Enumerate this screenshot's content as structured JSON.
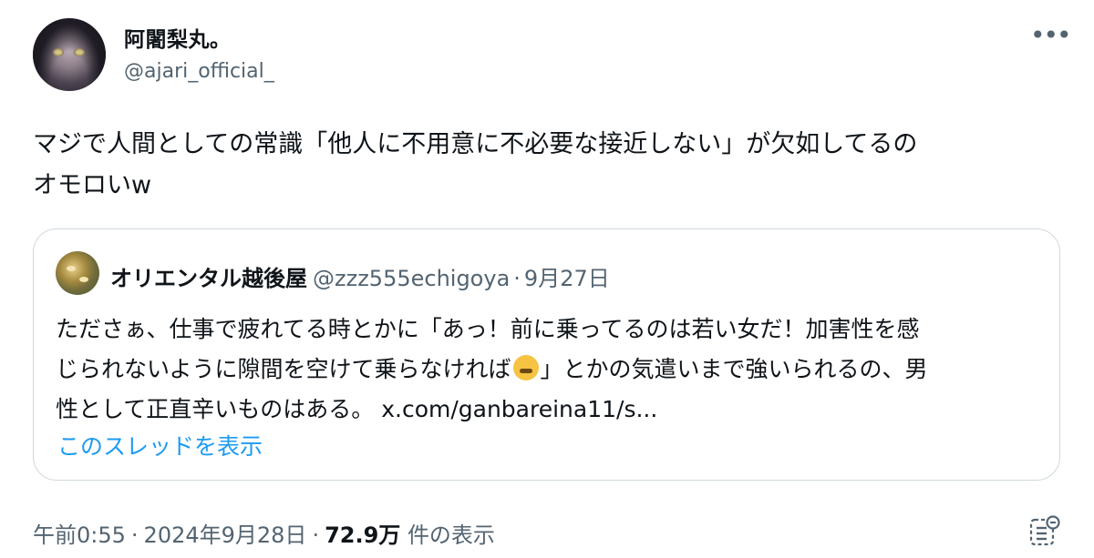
{
  "tweet": {
    "author_name": "阿闍梨丸。",
    "author_handle": "@ajari_official_",
    "more_label": "•••",
    "text_line1": "マジで人間としての常識「他人に不用意に不必要な接近しない」が欠如してるの",
    "text_line2": "オモロいw",
    "time": "午前0:55",
    "date": "2024年9月28日",
    "views_count": "72.9万",
    "views_label": "件の表示",
    "separator": "·"
  },
  "quote": {
    "author_name": "オリエンタル越後屋",
    "author_handle": "@zzz555echigoya",
    "separator": "·",
    "date": "9月27日",
    "line1": "たださぁ、仕事で疲れてる時とかに「あっ！前に乗ってるのは若い女だ！加害性を感",
    "line2a": "じられないように隙間を空けて乗らなければ",
    "line2b": "」とかの気遣いまで強いられるの、男",
    "line3": "性として正直辛いものはある。",
    "link": "x.com/ganbareina11/s...",
    "show_thread": "このスレッドを表示"
  },
  "icons": {
    "more": "more-horizontal-icon",
    "analytics": "analytics-icon",
    "emoji": "face-with-steam-emoji"
  },
  "colors": {
    "text": "#0f1419",
    "secondary": "#536471",
    "link": "#1d9bf0",
    "border": "#cfd9de"
  }
}
